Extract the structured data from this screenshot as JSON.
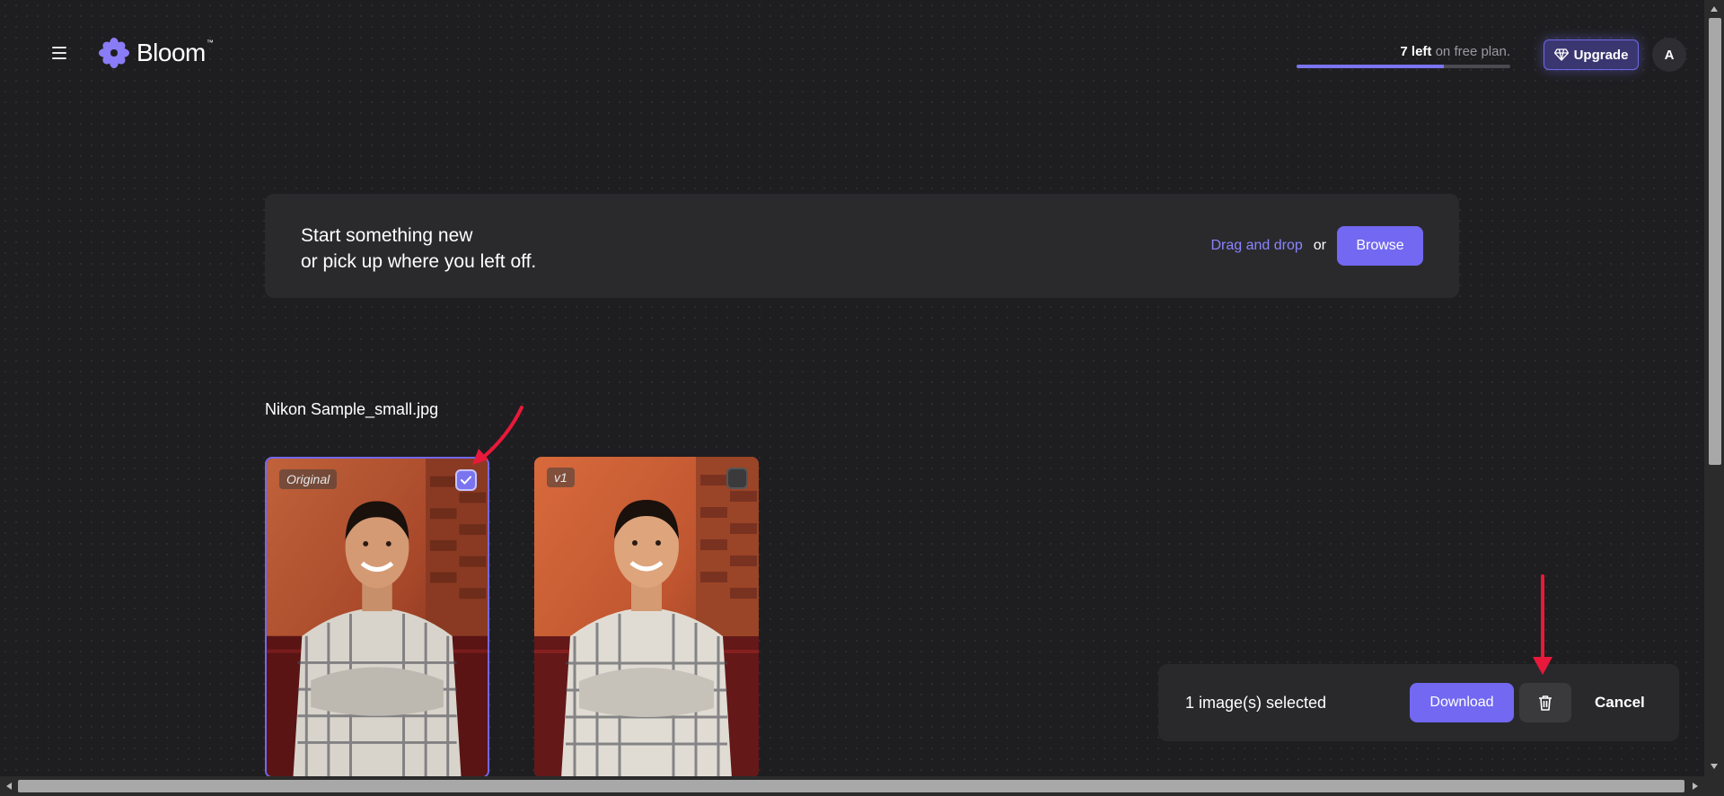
{
  "app": {
    "name": "Bloom",
    "trademark": "™"
  },
  "plan": {
    "remaining": "7 left",
    "suffix": "on free plan.",
    "used_fraction": 0.69
  },
  "header": {
    "upgrade_label": "Upgrade",
    "avatar_initial": "A"
  },
  "upload": {
    "heading_line1": "Start something new",
    "heading_line2": "or pick up where you left off.",
    "drag_label": "Drag and drop",
    "or_label": "or",
    "browse_label": "Browse"
  },
  "file": {
    "name": "Nikon Sample_small.jpg",
    "versions": [
      {
        "label": "Original",
        "selected": true
      },
      {
        "label": "v1",
        "selected": false
      }
    ]
  },
  "selection_bar": {
    "count_text": "1 image(s) selected",
    "download_label": "Download",
    "cancel_label": "Cancel"
  },
  "colors": {
    "accent": "#7268f2",
    "background": "#1e1e20",
    "card": "#2a2a2d",
    "annotation_arrow": "#e8193a"
  },
  "icons": [
    "menu-icon",
    "bloom-logo-icon",
    "diamond-icon",
    "check-icon",
    "trash-icon"
  ]
}
